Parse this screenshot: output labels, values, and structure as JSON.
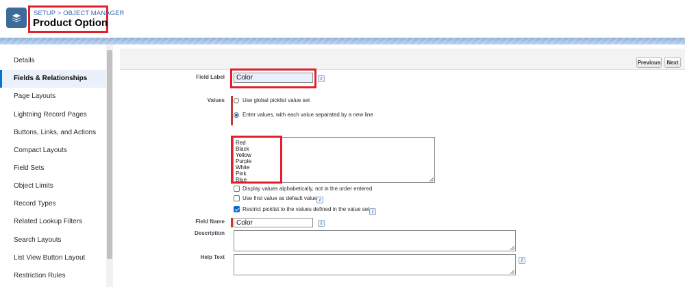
{
  "header": {
    "breadcrumb": "SETUP > OBJECT MANAGER",
    "title": "Product Option",
    "app_icon": "layers-icon"
  },
  "sidebar": {
    "items": [
      {
        "label": "Details",
        "active": false
      },
      {
        "label": "Fields & Relationships",
        "active": true
      },
      {
        "label": "Page Layouts",
        "active": false
      },
      {
        "label": "Lightning Record Pages",
        "active": false
      },
      {
        "label": "Buttons, Links, and Actions",
        "active": false
      },
      {
        "label": "Compact Layouts",
        "active": false
      },
      {
        "label": "Field Sets",
        "active": false
      },
      {
        "label": "Object Limits",
        "active": false
      },
      {
        "label": "Record Types",
        "active": false
      },
      {
        "label": "Related Lookup Filters",
        "active": false
      },
      {
        "label": "Search Layouts",
        "active": false
      },
      {
        "label": "List View Button Layout",
        "active": false
      },
      {
        "label": "Restriction Rules",
        "active": false
      }
    ]
  },
  "toolbar": {
    "previous_label": "Previous",
    "next_label": "Next"
  },
  "form": {
    "field_label": {
      "label": "Field Label",
      "value": "Color"
    },
    "values": {
      "label": "Values",
      "option_global": "Use global picklist value set",
      "option_enter": "Enter values, with each value separated by a new line",
      "selected_option": "option_enter",
      "items": [
        "Red",
        "Black",
        "Yellow",
        "Purple",
        "White",
        "Pink",
        "Blue"
      ]
    },
    "checkboxes": {
      "alphabetical": {
        "label": "Display values alphabetically, not in the order entered",
        "checked": false
      },
      "first_default": {
        "label": "Use first value as default value",
        "checked": false
      },
      "restrict": {
        "label": "Restrict picklist to the values defined in the value set",
        "checked": true
      }
    },
    "field_name": {
      "label": "Field Name",
      "value": "Color"
    },
    "description": {
      "label": "Description",
      "value": ""
    },
    "help_text": {
      "label": "Help Text",
      "value": ""
    },
    "info_icon": "i"
  },
  "colors": {
    "brand": "#3c6a9a",
    "link": "#3c6cb0",
    "highlight_box": "#e0202b",
    "required_bar": "#c23934",
    "active_nav_bg": "#eaf1fb"
  }
}
